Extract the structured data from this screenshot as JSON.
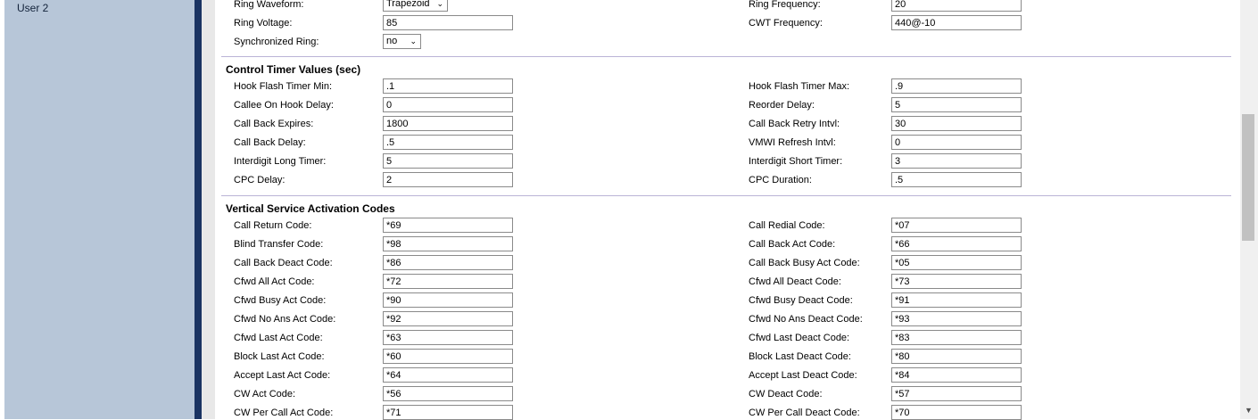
{
  "sidebar": {
    "item_label": "User 2"
  },
  "top_rows": {
    "ring_waveform": {
      "label": "Ring Waveform:",
      "value": "Trapezoid"
    },
    "ring_frequency": {
      "label": "Ring Frequency:",
      "value": "20"
    },
    "ring_voltage": {
      "label": "Ring Voltage:",
      "value": "85"
    },
    "cwt_frequency": {
      "label": "CWT Frequency:",
      "value": "440@-10"
    },
    "synchronized_ring": {
      "label": "Synchronized Ring:",
      "value": "no"
    }
  },
  "control_timer": {
    "title": "Control Timer Values (sec)",
    "rows": [
      {
        "left_label": "Hook Flash Timer Min:",
        "left_value": ".1",
        "right_label": "Hook Flash Timer Max:",
        "right_value": ".9"
      },
      {
        "left_label": "Callee On Hook Delay:",
        "left_value": "0",
        "right_label": "Reorder Delay:",
        "right_value": "5"
      },
      {
        "left_label": "Call Back Expires:",
        "left_value": "1800",
        "right_label": "Call Back Retry Intvl:",
        "right_value": "30"
      },
      {
        "left_label": "Call Back Delay:",
        "left_value": ".5",
        "right_label": "VMWI Refresh Intvl:",
        "right_value": "0"
      },
      {
        "left_label": "Interdigit Long Timer:",
        "left_value": "5",
        "right_label": "Interdigit Short Timer:",
        "right_value": "3"
      },
      {
        "left_label": "CPC Delay:",
        "left_value": "2",
        "right_label": "CPC Duration:",
        "right_value": ".5"
      }
    ]
  },
  "vsac": {
    "title": "Vertical Service Activation Codes",
    "rows": [
      {
        "left_label": "Call Return Code:",
        "left_value": "*69",
        "right_label": "Call Redial Code:",
        "right_value": "*07"
      },
      {
        "left_label": "Blind Transfer Code:",
        "left_value": "*98",
        "right_label": "Call Back Act Code:",
        "right_value": "*66"
      },
      {
        "left_label": "Call Back Deact Code:",
        "left_value": "*86",
        "right_label": "Call Back Busy Act Code:",
        "right_value": "*05"
      },
      {
        "left_label": "Cfwd All Act Code:",
        "left_value": "*72",
        "right_label": "Cfwd All Deact Code:",
        "right_value": "*73"
      },
      {
        "left_label": "Cfwd Busy Act Code:",
        "left_value": "*90",
        "right_label": "Cfwd Busy Deact Code:",
        "right_value": "*91"
      },
      {
        "left_label": "Cfwd No Ans Act Code:",
        "left_value": "*92",
        "right_label": "Cfwd No Ans Deact Code:",
        "right_value": "*93"
      },
      {
        "left_label": "Cfwd Last Act Code:",
        "left_value": "*63",
        "right_label": "Cfwd Last Deact Code:",
        "right_value": "*83"
      },
      {
        "left_label": "Block Last Act Code:",
        "left_value": "*60",
        "right_label": "Block Last Deact Code:",
        "right_value": "*80"
      },
      {
        "left_label": "Accept Last Act Code:",
        "left_value": "*64",
        "right_label": "Accept Last Deact Code:",
        "right_value": "*84"
      },
      {
        "left_label": "CW Act Code:",
        "left_value": "*56",
        "right_label": "CW Deact Code:",
        "right_value": "*57"
      },
      {
        "left_label": "CW Per Call Act Code:",
        "left_value": "*71",
        "right_label": "CW Per Call Deact Code:",
        "right_value": "*70"
      }
    ]
  },
  "colors": {
    "sidebar_bg": "#b7c6d8",
    "divider": "#1a3362",
    "section_line": "#bab4d6"
  }
}
